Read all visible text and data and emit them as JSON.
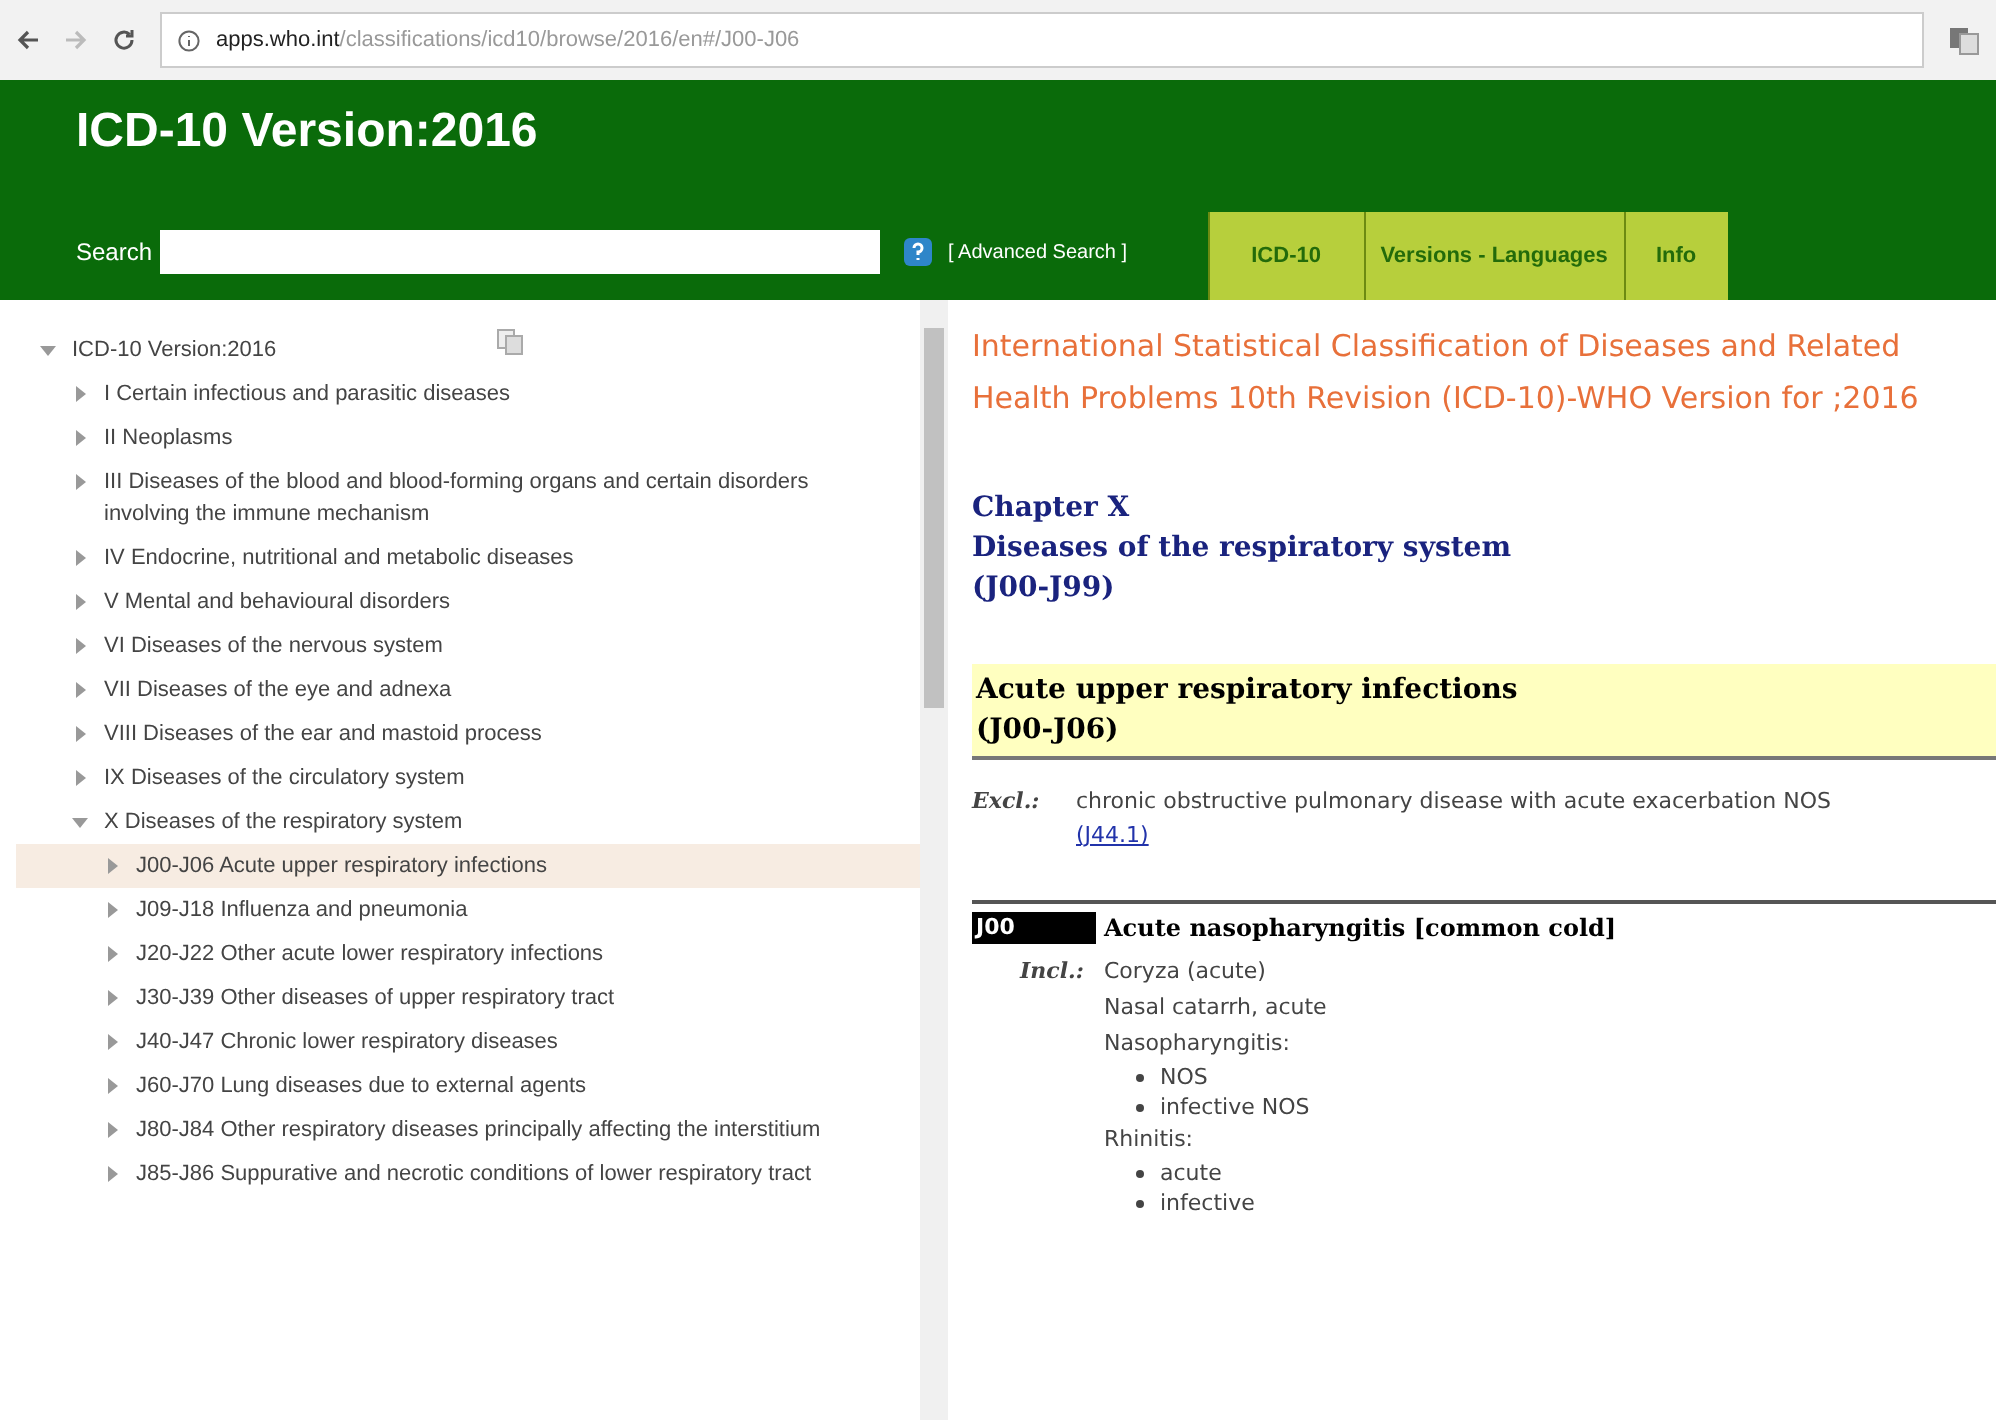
{
  "browser": {
    "url_host": "apps.who.int",
    "url_path": "/classifications/icd10/browse/2016/en#/J00-J06"
  },
  "header": {
    "title": "ICD-10 Version:2016",
    "search_label": "Search",
    "advanced_search": "[ Advanced Search ]"
  },
  "tabs": [
    {
      "label": "ICD-10",
      "selected": false
    },
    {
      "label": "Versions - Languages",
      "selected": false
    },
    {
      "label": "Info",
      "selected": false
    }
  ],
  "tree": [
    {
      "label": "ICD-10 Version:2016",
      "expanded": true,
      "selected": false,
      "children": [
        {
          "label": "I Certain infectious and parasitic diseases",
          "expanded": false,
          "selected": false
        },
        {
          "label": "II Neoplasms",
          "expanded": false,
          "selected": false
        },
        {
          "label": "III Diseases of the blood and blood-forming organs and certain disorders involving the immune mechanism",
          "expanded": false,
          "selected": false
        },
        {
          "label": "IV Endocrine, nutritional and metabolic diseases",
          "expanded": false,
          "selected": false
        },
        {
          "label": "V Mental and behavioural disorders",
          "expanded": false,
          "selected": false
        },
        {
          "label": "VI Diseases of the nervous system",
          "expanded": false,
          "selected": false
        },
        {
          "label": "VII Diseases of the eye and adnexa",
          "expanded": false,
          "selected": false
        },
        {
          "label": "VIII Diseases of the ear and mastoid process",
          "expanded": false,
          "selected": false
        },
        {
          "label": "IX Diseases of the circulatory system",
          "expanded": false,
          "selected": false
        },
        {
          "label": "X Diseases of the respiratory system",
          "expanded": true,
          "selected": false,
          "children": [
            {
              "label": "J00-J06 Acute upper respiratory infections",
              "expanded": false,
              "selected": true
            },
            {
              "label": "J09-J18 Influenza and pneumonia",
              "expanded": false,
              "selected": false
            },
            {
              "label": "J20-J22 Other acute lower respiratory infections",
              "expanded": false,
              "selected": false
            },
            {
              "label": "J30-J39 Other diseases of upper respiratory tract",
              "expanded": false,
              "selected": false
            },
            {
              "label": "J40-J47 Chronic lower respiratory diseases",
              "expanded": false,
              "selected": false
            },
            {
              "label": "J60-J70 Lung diseases due to external agents",
              "expanded": false,
              "selected": false
            },
            {
              "label": "J80-J84 Other respiratory diseases principally affecting the interstitium",
              "expanded": false,
              "selected": false
            },
            {
              "label": "J85-J86 Suppurative and necrotic conditions of lower respiratory tract",
              "expanded": false,
              "selected": false
            }
          ]
        }
      ]
    }
  ],
  "content": {
    "title": "International Statistical Classification of Diseases and Related Health Problems 10th Revision (ICD-10)-WHO Version for ;2016",
    "chapter": [
      "Chapter X",
      "Diseases of the respiratory system",
      "(J00-J99)"
    ],
    "block": [
      "Acute upper respiratory infections",
      "(J00-J06)"
    ],
    "excl": {
      "label": "Excl.:",
      "text": "chronic obstructive pulmonary disease with acute exacerbation NOS",
      "link": "(J44.1)"
    },
    "code": {
      "code": "J00",
      "title": "Acute nasopharyngitis [common cold]",
      "incl_label": "Incl.:",
      "incl": [
        {
          "text": "Coryza (acute)"
        },
        {
          "text": "Nasal catarrh, acute"
        },
        {
          "text": "Nasopharyngitis:",
          "items": [
            "NOS",
            "infective NOS"
          ]
        },
        {
          "text": "Rhinitis:",
          "items": [
            "acute",
            "infective"
          ]
        }
      ]
    }
  }
}
